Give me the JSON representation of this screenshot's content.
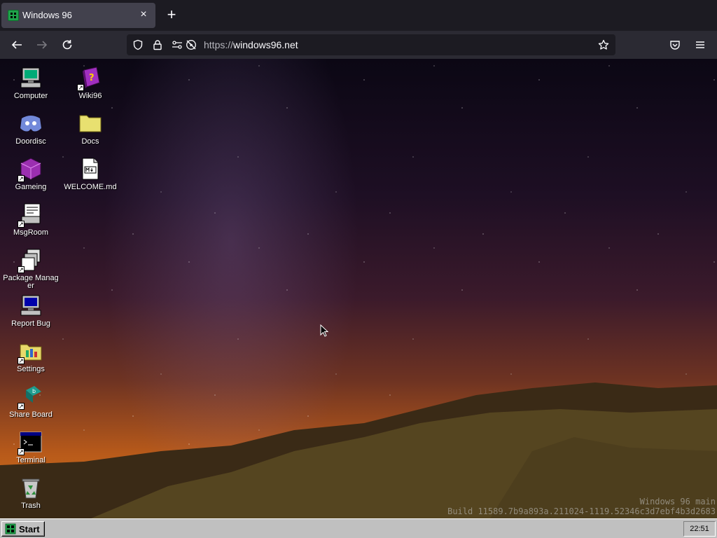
{
  "browser": {
    "tab": {
      "title": "Windows 96",
      "close": "×"
    },
    "new_tab": "+",
    "url": {
      "scheme": "https://",
      "host": "windows96.net"
    }
  },
  "desktop": {
    "icons": [
      {
        "label": "Computer",
        "icon": "computer-icon"
      },
      {
        "label": "Doordisc",
        "icon": "discord-icon"
      },
      {
        "label": "Gameing",
        "icon": "game-cube-icon"
      },
      {
        "label": "MsgRoom",
        "icon": "msgroom-icon"
      },
      {
        "label": "Package Manager",
        "icon": "package-icon"
      },
      {
        "label": "Report Bug",
        "icon": "report-bug-icon"
      },
      {
        "label": "Settings",
        "icon": "settings-folder-icon"
      },
      {
        "label": "Share Board",
        "icon": "share-board-icon"
      },
      {
        "label": "Terminal",
        "icon": "terminal-icon"
      },
      {
        "label": "Trash",
        "icon": "trash-icon"
      },
      {
        "label": "Wiki96",
        "icon": "wiki-book-icon"
      },
      {
        "label": "Docs",
        "icon": "folder-icon"
      },
      {
        "label": "WELCOME.md",
        "icon": "markdown-file-icon"
      }
    ],
    "watermark": {
      "line1": "Windows 96 main",
      "line2": "Build 11589.7b9a893a.211024-1119.52346c3d7ebf4b3d2683"
    }
  },
  "taskbar": {
    "start_label": "Start",
    "clock": "22:51"
  },
  "colors": {
    "tab_bg": "#42414d",
    "toolbar_bg": "#2b2a33",
    "urlbar_bg": "#1c1b22",
    "taskbar_bg": "#c0c0c0"
  }
}
